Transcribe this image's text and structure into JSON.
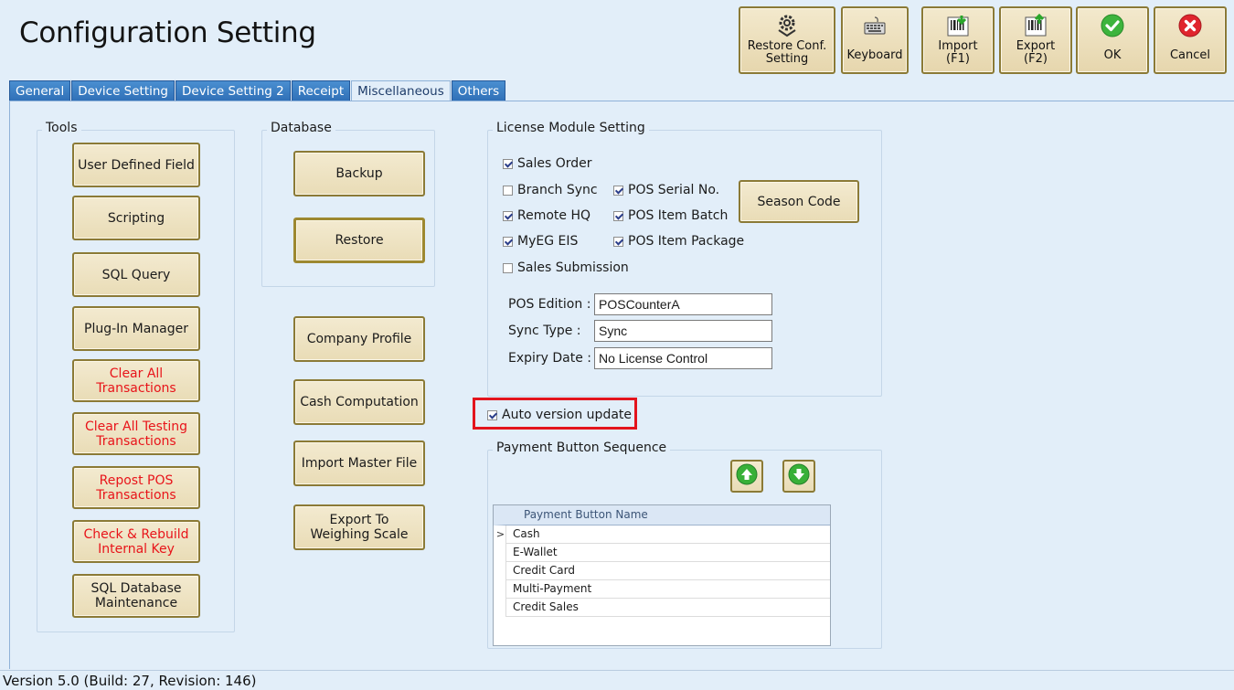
{
  "window": {
    "title": "Configuration Setting"
  },
  "toolbar": {
    "restore_conf": "Restore Conf.\nSetting",
    "keyboard": "Keyboard",
    "import": "Import\n(F1)",
    "export": "Export\n(F2)",
    "ok": "OK",
    "cancel": "Cancel"
  },
  "tabs": [
    "General",
    "Device Setting",
    "Device Setting 2",
    "Receipt",
    "Miscellaneous",
    "Others"
  ],
  "active_tab": "Miscellaneous",
  "tools": {
    "label": "Tools",
    "buttons": [
      "User Defined Field",
      "Scripting",
      "SQL Query",
      "Plug-In Manager",
      "Clear All\nTransactions",
      "Clear All Testing\nTransactions",
      "Repost POS\nTransactions",
      "Check & Rebuild\nInternal Key",
      "SQL Database\nMaintenance"
    ]
  },
  "database": {
    "label": "Database",
    "backup": "Backup",
    "restore": "Restore"
  },
  "misc_buttons": [
    "Company Profile",
    "Cash Computation",
    "Import Master File",
    "Export To\nWeighing Scale"
  ],
  "license": {
    "label": "License Module Setting",
    "checks": [
      {
        "label": "Sales Order",
        "checked": true
      },
      {
        "label": "Branch Sync",
        "checked": false
      },
      {
        "label": "POS Serial No.",
        "checked": true
      },
      {
        "label": "Remote HQ",
        "checked": true
      },
      {
        "label": "POS Item Batch",
        "checked": true
      },
      {
        "label": "MyEG EIS",
        "checked": true
      },
      {
        "label": "POS Item Package",
        "checked": true
      },
      {
        "label": "Sales Submission",
        "checked": false
      }
    ],
    "season_code": "Season Code",
    "pos_edition_label": "POS Edition :",
    "pos_edition": "POSCounterA",
    "sync_type_label": "Sync Type :",
    "sync_type": "Sync",
    "expiry_label": "Expiry Date :",
    "expiry": "No License Control"
  },
  "auto_update": {
    "label": "Auto version update",
    "checked": true
  },
  "payment": {
    "label": "Payment Button Sequence",
    "column": "Payment Button Name",
    "rows": [
      "Cash",
      "E-Wallet",
      "Credit Card",
      "Multi-Payment",
      "Credit Sales"
    ],
    "selected_marker": ">"
  },
  "status": {
    "version": "Version 5.0 (Build: 27, Revision: 146)"
  },
  "colors": {
    "accent_tab": "#3a7fc4",
    "button_border": "#8b7a36",
    "danger_text": "#e8141a",
    "highlight": "#e3141d"
  }
}
